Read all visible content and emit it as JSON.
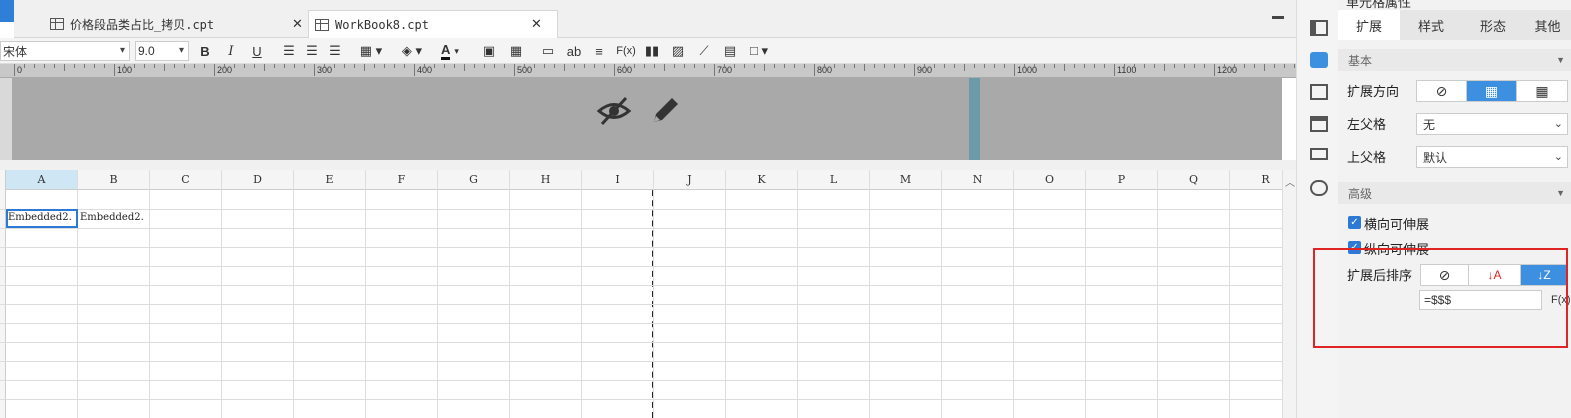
{
  "tabs": [
    {
      "label": "价格段品类占比_拷贝.cpt",
      "active": false
    },
    {
      "label": "WorkBook8.cpt",
      "active": true
    }
  ],
  "toolbar": {
    "font_name": "宋体",
    "font_size": "9.0",
    "bold": "B",
    "italic": "I",
    "underline": "U",
    "text_a": "A",
    "ab": "ab",
    "fx": "F(x)"
  },
  "ruler": {
    "labels": [
      "0",
      "100",
      "200",
      "300",
      "400",
      "500",
      "600",
      "700",
      "800",
      "900",
      "1000",
      "1100",
      "1200"
    ]
  },
  "grid": {
    "columns": [
      "A",
      "B",
      "C",
      "D",
      "E",
      "F",
      "G",
      "H",
      "I",
      "J",
      "K",
      "L",
      "M",
      "N",
      "O",
      "P",
      "Q",
      "R"
    ],
    "selected_column": "A",
    "cells": [
      {
        "col": "A",
        "row": 1,
        "text": "Embedded2."
      },
      {
        "col": "B",
        "row": 1,
        "text": "Embedded2."
      }
    ]
  },
  "panel": {
    "title": "单元格属性",
    "tabs": [
      "扩展",
      "样式",
      "形态",
      "其他"
    ],
    "active_tab": "扩展",
    "basic_section": "基本",
    "expand_dir_label": "扩展方向",
    "left_parent_label": "左父格",
    "left_parent_value": "无",
    "top_parent_label": "上父格",
    "top_parent_value": "默认",
    "advanced_section": "高级",
    "h_extend_label": "横向可伸展",
    "v_extend_label": "纵向可伸展",
    "sort_label": "扩展后排序",
    "formula_value": "=$$$",
    "formula_btn": "F(x)"
  },
  "colors": {
    "accent": "#3d8fe0",
    "highlight_box": "#e02424",
    "gray_area": "#a9a9a9"
  }
}
